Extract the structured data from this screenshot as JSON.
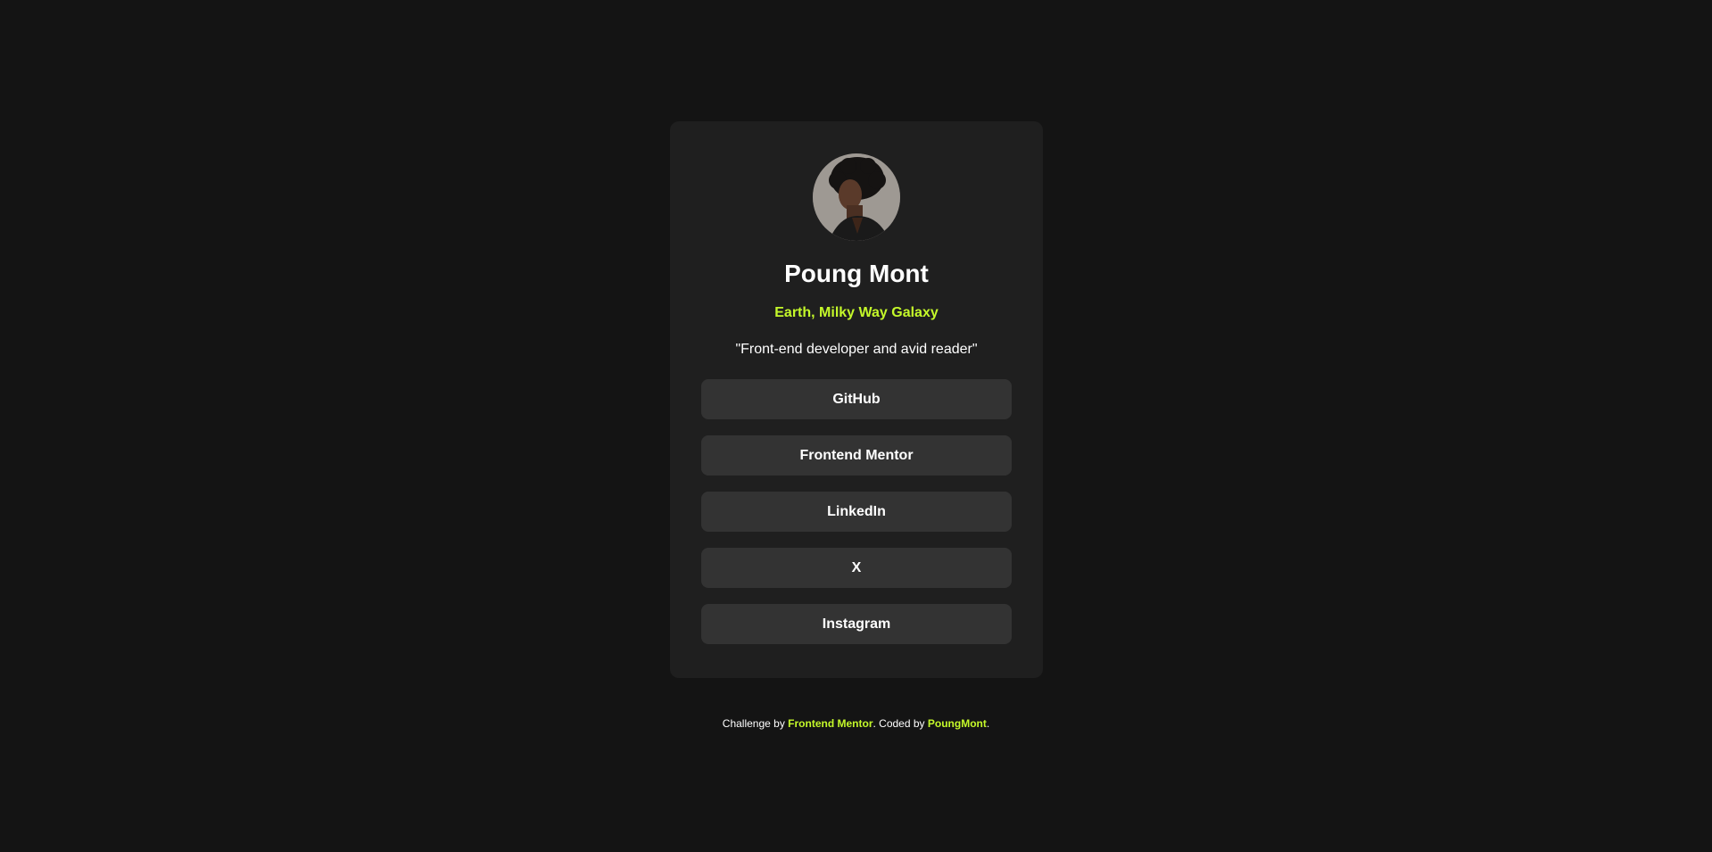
{
  "profile": {
    "name": "Poung Mont",
    "location": "Earth, Milky Way Galaxy",
    "bio": "\"Front-end developer and avid reader\""
  },
  "links": [
    {
      "label": "GitHub"
    },
    {
      "label": "Frontend Mentor"
    },
    {
      "label": "LinkedIn"
    },
    {
      "label": "X"
    },
    {
      "label": "Instagram"
    }
  ],
  "footer": {
    "prefix": "Challenge by ",
    "challenge_link": "Frontend Mentor",
    "middle": ". Coded by ",
    "author_link": "PoungMont",
    "suffix": "."
  },
  "colors": {
    "page_background": "#141414",
    "card_background": "#1f1f1f",
    "button_background": "#333333",
    "accent": "#c4f82a",
    "text": "#ffffff"
  }
}
